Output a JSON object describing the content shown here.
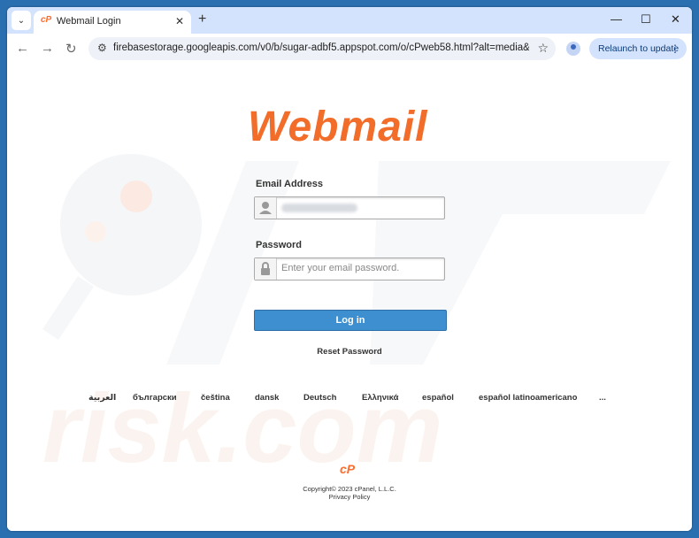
{
  "browser": {
    "tab_title": "Webmail Login",
    "url": "firebasestorage.googleapis.com/v0/b/sugar-adbf5.appspot.com/o/cPweb58.html?alt=media&toke...",
    "relaunch_label": "Relaunch to update"
  },
  "login": {
    "logo_text": "Webmail",
    "email_label": "Email Address",
    "password_label": "Password",
    "password_placeholder": "Enter your email password.",
    "login_button": "Log in",
    "reset_link": "Reset Password"
  },
  "languages": [
    "العربية",
    "български",
    "čeština",
    "dansk",
    "Deutsch",
    "Ελληνικά",
    "español",
    "español latinoamericano",
    "..."
  ],
  "footer": {
    "copyright": "Copyright© 2023 cPanel, L.L.C.",
    "privacy": "Privacy Policy"
  },
  "colors": {
    "brand_orange": "#f26c2a",
    "button_blue": "#3d8fcf",
    "chrome_blue": "#d3e3fd"
  }
}
